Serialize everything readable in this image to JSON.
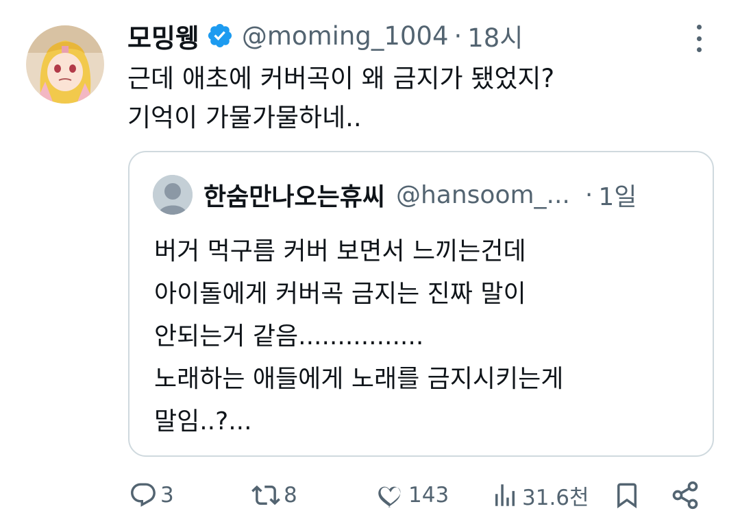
{
  "tweet": {
    "author_name": "모밍웽",
    "author_handle": "@moming_1004",
    "separator": "·",
    "time": "18시",
    "text_lines": [
      "근데 애초에 커버곡이 왜 금지가 됐었지?",
      "기억이 가물가물하네.."
    ]
  },
  "quote": {
    "author_name": "한숨만나오는휴씨",
    "author_handle": "@hansoom_...",
    "separator": "·",
    "time": "1일",
    "text_lines": [
      "버거 먹구름 커버 보면서 느끼는건데",
      "아이돌에게 커버곡 금지는 진짜 말이",
      "안되는거 같음................",
      "노래하는 애들에게 노래를 금지시키는게",
      "말임..?..."
    ]
  },
  "actions": {
    "reply_count": "3",
    "retweet_count": "8",
    "like_count": "143",
    "views_count": "31.6천"
  },
  "icons": {
    "verified": "verified-badge-icon",
    "more": "more-vertical-icon",
    "reply": "reply-icon",
    "retweet": "retweet-icon",
    "like": "heart-icon",
    "views": "views-icon",
    "bookmark": "bookmark-icon",
    "share": "share-icon"
  },
  "colors": {
    "verified_blue": "#1d9bf0",
    "secondary_text": "#536471",
    "border": "#cfd9de"
  }
}
